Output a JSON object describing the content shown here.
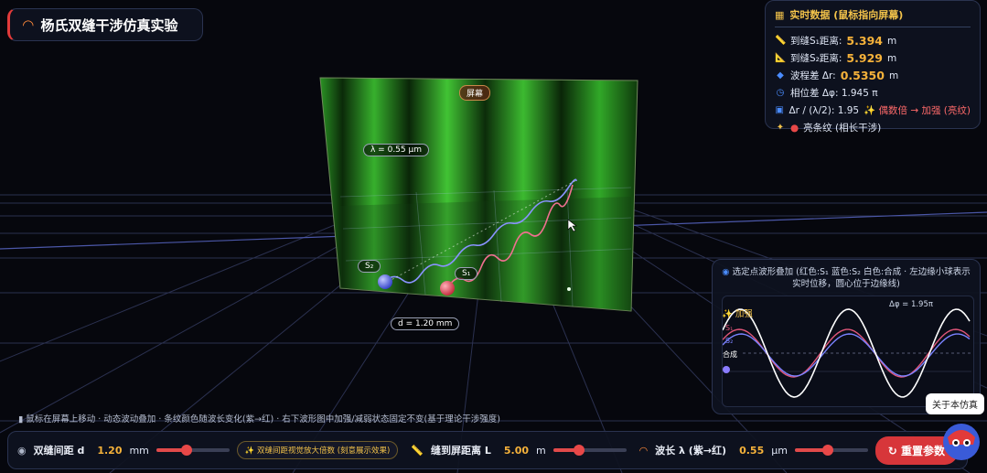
{
  "title": {
    "icon": "rainbow-icon",
    "text": "杨氏双缝干涉仿真实验"
  },
  "scene": {
    "screen_label": "屏幕",
    "wavelength_tag": "λ = 0.55 μm",
    "slit_distance_tag": "d = 1.20 mm",
    "s1_label": "S₁",
    "s2_label": "S₂",
    "colors": {
      "screen_green": "#2fa22a",
      "s1_ball": "#e4485a",
      "s2_ball": "#4b5fe8"
    }
  },
  "data_panel": {
    "header": "实时数据 (鼠标指向屏幕)",
    "r1_label": "到缝S₁距离:",
    "r1_value": "5.394",
    "r1_unit": "m",
    "r2_label": "到缝S₂距离:",
    "r2_value": "5.929",
    "r2_unit": "m",
    "dr_label": "波程差 Δr:",
    "dr_value": "0.5350",
    "dr_unit": "m",
    "phase_label": "相位差 Δφ: 1.945 π",
    "ratio_label": "Δr / (λ/2): 1.95",
    "ratio_result": "✨ 偶数倍 → 加强 (亮纹)",
    "fringe_label": "亮条纹 (相长干涉)"
  },
  "wave_panel": {
    "header": "选定点波形叠加 (红色:S₁ 蓝色:S₂ 白色:合成 · 左边缘小球表示实时位移，圆心位于边缘线)",
    "strengthen_label": "✨ 加强",
    "phase_label": "Δφ = 1.95π",
    "s1_label": "S₁",
    "s2_label": "S₂",
    "sum_label": "合成",
    "colors": {
      "s1": "#e0567a",
      "s2": "#7a82ff",
      "sum": "#ffffff"
    }
  },
  "footer_hint": "▮ 鼠标在屏幕上移动 · 动态波动叠加 · 条纹颜色随波长变化(紫→红) · 右下波形图中加强/减弱状态固定不变(基于理论干涉强度)",
  "controls": {
    "slit_label": "双缝间距 d",
    "slit_value": "1.20",
    "slit_unit": "mm",
    "slit_fraction": 0.42,
    "hint": "✨ 双缝间距视觉放大倍数 (刻意展示效果)",
    "dist_label": "缝到屏距离 L",
    "dist_value": "5.00",
    "dist_unit": "m",
    "dist_fraction": 0.36,
    "wl_label": "波长 λ (紫→红)",
    "wl_value": "0.55",
    "wl_unit": "μm",
    "wl_fraction": 0.45,
    "reset_label": "↻ 重置参数"
  },
  "about": {
    "label": "关于本仿真"
  }
}
